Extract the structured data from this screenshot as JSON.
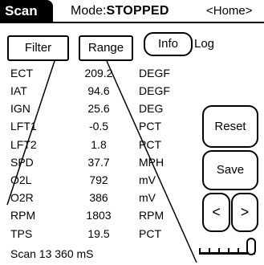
{
  "header": {
    "title": "Scan",
    "mode_prefix": "Mode:",
    "mode_value": "STOPPED",
    "home_label": "<Home>"
  },
  "toolbar": {
    "filter_label": "Filter",
    "range_label": "Range",
    "info_label": "Info",
    "log_label": "Log"
  },
  "readings": [
    {
      "label": "ECT",
      "value": "209.2",
      "unit": "DEGF"
    },
    {
      "label": "IAT",
      "value": "94.6",
      "unit": "DEGF"
    },
    {
      "label": "IGN",
      "value": "25.6",
      "unit": "DEG"
    },
    {
      "label": "LFT1",
      "value": "-0.5",
      "unit": "PCT"
    },
    {
      "label": "LFT2",
      "value": "1.8",
      "unit": "PCT"
    },
    {
      "label": "SPD",
      "value": "37.7",
      "unit": "MPH"
    },
    {
      "label": "O2L",
      "value": "792",
      "unit": "mV"
    },
    {
      "label": "O2R",
      "value": "386",
      "unit": "mV"
    },
    {
      "label": "RPM",
      "value": "1803",
      "unit": "RPM"
    },
    {
      "label": "TPS",
      "value": "19.5",
      "unit": "PCT"
    }
  ],
  "side_buttons": {
    "reset_label": "Reset",
    "save_label": "Save",
    "prev_label": "<",
    "next_label": ">"
  },
  "status": {
    "scan_text": "Scan  13 360 mS"
  },
  "slider": {
    "position_fraction": 0.95
  }
}
